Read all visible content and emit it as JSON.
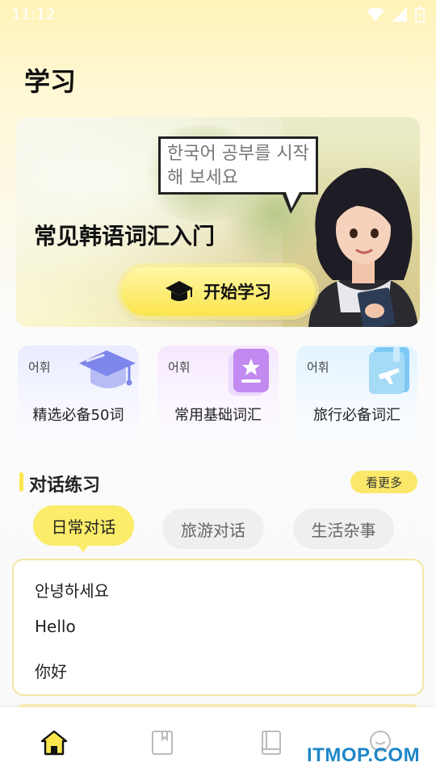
{
  "status_bar": {
    "time": "11:12",
    "icons": [
      "wifi-icon",
      "signal-icon",
      "battery-icon"
    ]
  },
  "page": {
    "title": "学习"
  },
  "banner": {
    "speech_text": "한국어 공부를 시작해 보세요",
    "title": "常见韩语词汇入门",
    "start_button": "开始学习"
  },
  "vocab_cards": [
    {
      "tag": "어휘",
      "label": "精选必备50词",
      "icon": "graduation-cap-icon"
    },
    {
      "tag": "어휘",
      "label": "常用基础词汇",
      "icon": "badge-card-icon"
    },
    {
      "tag": "어휘",
      "label": "旅行必备词汇",
      "icon": "travel-book-icon"
    }
  ],
  "dialogue_section": {
    "title": "对话练习",
    "more_label": "看更多",
    "tabs": [
      "日常对话",
      "旅游对话",
      "生活杂事"
    ],
    "active_tab": 0,
    "lines": [
      "안녕하세요",
      "Hello",
      "你好"
    ]
  },
  "bottom_nav": {
    "items": [
      "home-icon",
      "bookmark-icon",
      "book-icon",
      "profile-icon"
    ],
    "active": 0
  },
  "watermark": "ITMOP.COM",
  "colors": {
    "accent": "#fbe54d",
    "background_top": "#fff3b8",
    "watermark": "#1f86c8"
  }
}
